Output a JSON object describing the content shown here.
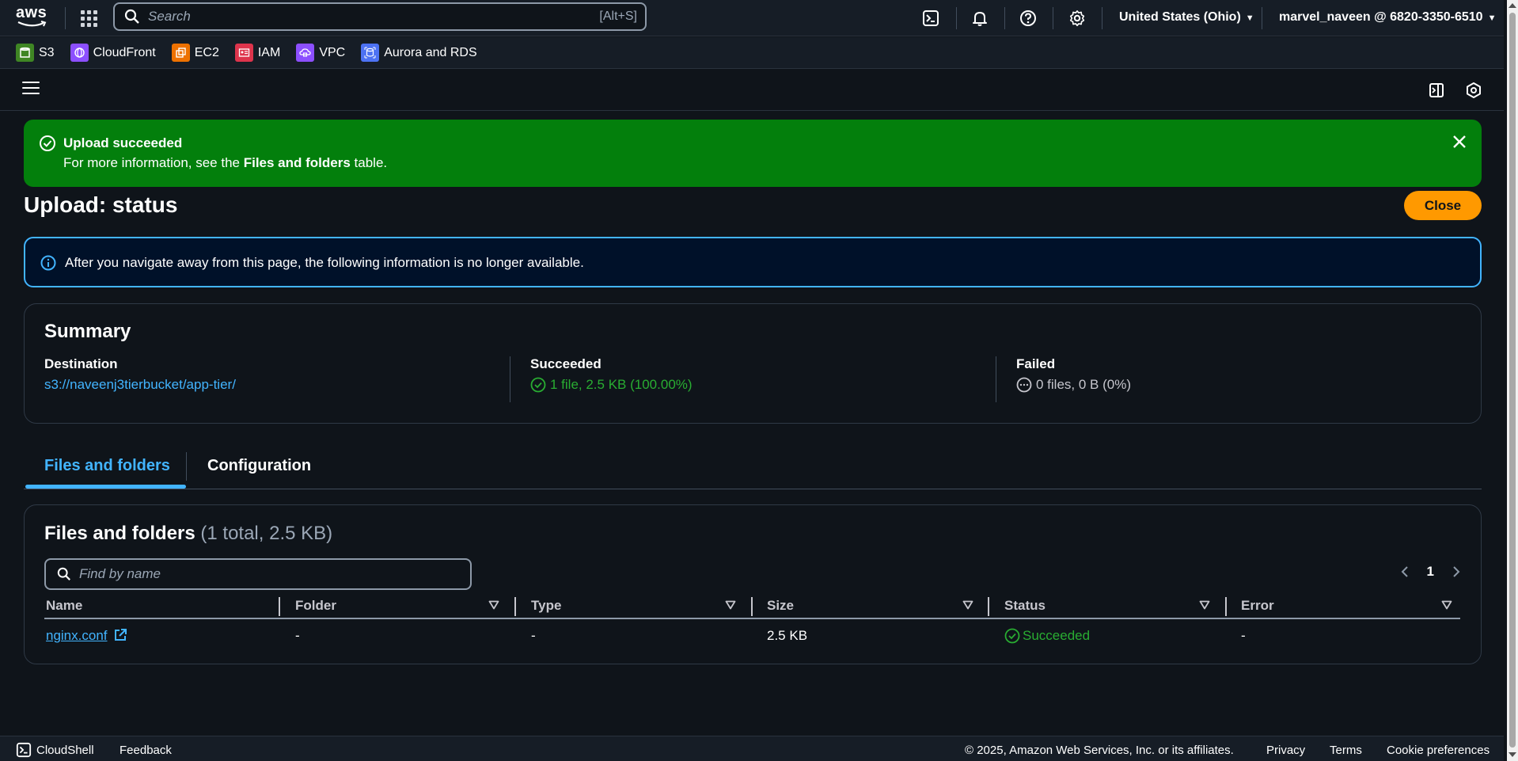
{
  "topnav": {
    "logo_text": "aws",
    "search_placeholder": "Search",
    "search_shortcut": "[Alt+S]",
    "region": "United States (Ohio)",
    "account": "marvel_naveen @ 6820-3350-6510"
  },
  "services": [
    {
      "label": "S3",
      "color": "#3f8624"
    },
    {
      "label": "CloudFront",
      "color": "#8c4fff"
    },
    {
      "label": "EC2",
      "color": "#ed7100"
    },
    {
      "label": "IAM",
      "color": "#dd344c"
    },
    {
      "label": "VPC",
      "color": "#8c4fff"
    },
    {
      "label": "Aurora and RDS",
      "color": "#4d72f3"
    }
  ],
  "flash": {
    "title": "Upload succeeded",
    "msg_prefix": "For more information, see the ",
    "msg_bold": "Files and folders",
    "msg_suffix": " table."
  },
  "page": {
    "title": "Upload: status",
    "close_label": "Close",
    "info": "After you navigate away from this page, the following information is no longer available."
  },
  "summary": {
    "title": "Summary",
    "destination_label": "Destination",
    "destination_value": "s3://naveenj3tierbucket/app-tier/",
    "succeeded_label": "Succeeded",
    "succeeded_value": "1 file, 2.5 KB (100.00%)",
    "failed_label": "Failed",
    "failed_value": "0 files, 0 B (0%)"
  },
  "tabs": {
    "files": "Files and folders",
    "config": "Configuration"
  },
  "files": {
    "title": "Files and folders",
    "count": "(1 total, 2.5 KB)",
    "find_placeholder": "Find by name",
    "page": "1",
    "columns": [
      "Name",
      "Folder",
      "Type",
      "Size",
      "Status",
      "Error"
    ],
    "rows": [
      {
        "name": "nginx.conf",
        "folder": "-",
        "type": "-",
        "size": "2.5 KB",
        "status": "Succeeded",
        "error": "-"
      }
    ]
  },
  "footer": {
    "cloudshell": "CloudShell",
    "feedback": "Feedback",
    "copyright": "© 2025, Amazon Web Services, Inc. or its affiliates.",
    "privacy": "Privacy",
    "terms": "Terms",
    "cookies": "Cookie preferences"
  }
}
